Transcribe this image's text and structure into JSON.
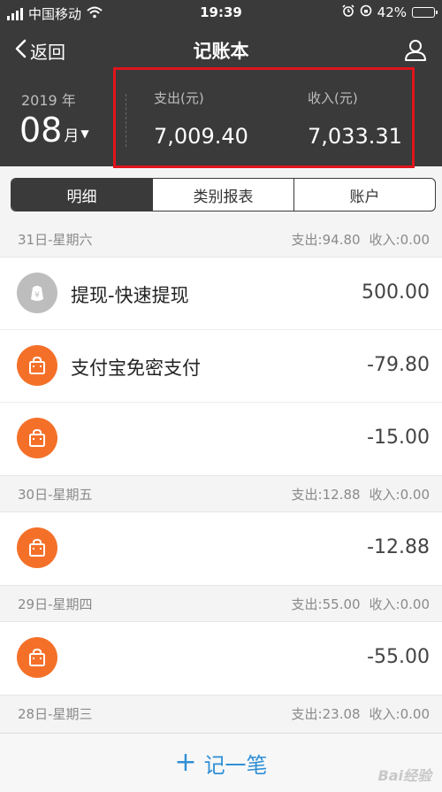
{
  "status_bar": {
    "carrier": "中国移动",
    "time": "19:39",
    "battery": "42%",
    "battery_level": 0.42
  },
  "nav": {
    "back_label": "返回",
    "title": "记账本"
  },
  "summary": {
    "year": "2019 年",
    "month": "08",
    "month_unit": "月",
    "expense_label": "支出(元)",
    "expense_value": "7,009.40",
    "income_label": "收入(元)",
    "income_value": "7,033.31"
  },
  "tabs": [
    {
      "label": "明细",
      "active": true
    },
    {
      "label": "类别报表",
      "active": false
    },
    {
      "label": "账户",
      "active": false
    }
  ],
  "days": [
    {
      "date": "31日-星期六",
      "expense": "支出:94.80",
      "income": "收入:0.00",
      "transactions": [
        {
          "name": "提现-快速提现",
          "amount": "500.00",
          "icon": "withdraw-icon",
          "color": "#bdbdbd"
        },
        {
          "name": "支付宝免密支付",
          "amount": "-79.80",
          "icon": "shopping-bag-icon",
          "color": "#f47029"
        },
        {
          "name": "",
          "amount": "-15.00",
          "icon": "shopping-bag-icon",
          "color": "#f47029"
        }
      ]
    },
    {
      "date": "30日-星期五",
      "expense": "支出:12.88",
      "income": "收入:0.00",
      "transactions": [
        {
          "name": "",
          "amount": "-12.88",
          "icon": "shopping-bag-icon",
          "color": "#f47029"
        }
      ]
    },
    {
      "date": "29日-星期四",
      "expense": "支出:55.00",
      "income": "收入:0.00",
      "transactions": [
        {
          "name": "",
          "amount": "-55.00",
          "icon": "shopping-bag-icon",
          "color": "#f47029"
        }
      ]
    },
    {
      "date": "28日-星期三",
      "expense": "支出:23.08",
      "income": "收入:0.00",
      "transactions": []
    }
  ],
  "bottom": {
    "add_label": "记一笔",
    "plus": "+"
  },
  "watermark": "Bai经验",
  "colors": {
    "header_bg": "#3a3a3a",
    "accent_orange": "#f47029",
    "accent_blue": "#2f8fd6",
    "highlight_red": "#e0141c"
  }
}
